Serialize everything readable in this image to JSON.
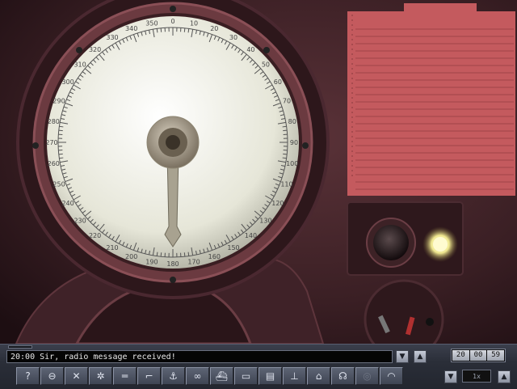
{
  "message": {
    "time": "20:00",
    "text": "Sir, radio message received!"
  },
  "clock": [
    "20",
    "00",
    "59"
  ],
  "time_compression": "1x",
  "dial": {
    "labels": [
      "350",
      "0",
      "10",
      "20",
      "30",
      "40",
      "50",
      "60",
      "70",
      "80",
      "90",
      "100",
      "110",
      "120",
      "130",
      "140",
      "150",
      "160",
      "170",
      "180",
      "190",
      "200",
      "210",
      "220",
      "230",
      "240",
      "250",
      "260",
      "270",
      "280",
      "290",
      "300",
      "310",
      "320",
      "330",
      "340"
    ],
    "needle_bearing_deg": 180
  },
  "toolbar": {
    "icons": [
      "help-icon",
      "periscope-icon",
      "compass-icon",
      "sun-icon",
      "torpedo-icon",
      "deck-gun-icon",
      "aa-gun-icon",
      "engine-icon",
      "ship-icon",
      "map-icon",
      "radio-icon",
      "sonar-icon",
      "crew-icon",
      "headphones-icon",
      "hydrophone-icon",
      "gauge-icon"
    ],
    "glyphs": [
      "?",
      "⊖",
      "✕",
      "✲",
      "═",
      "⌐",
      "⚓",
      "∞",
      "⛴",
      "▭",
      "▤",
      "⊥",
      "⌂",
      "☊",
      "◎",
      "◠"
    ]
  },
  "colors": {
    "panel": "#3a2025",
    "dial_face": "#f2f2e8",
    "lamp": "#f4f0b0"
  }
}
